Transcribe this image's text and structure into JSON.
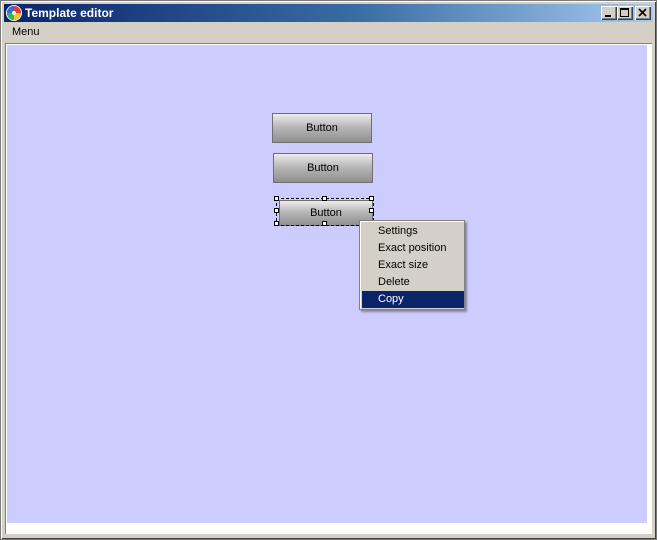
{
  "window": {
    "title": "Template editor",
    "controls": [
      "minimize-icon",
      "maximize-icon",
      "close-icon"
    ]
  },
  "menubar": {
    "items": [
      "Menu"
    ]
  },
  "canvas": {
    "background": "#ccccff",
    "buttons": [
      {
        "label": "Button",
        "selected": false
      },
      {
        "label": "Button",
        "selected": false
      },
      {
        "label": "Button",
        "selected": true
      }
    ]
  },
  "context_menu": {
    "items": [
      {
        "label": "Settings",
        "highlighted": false
      },
      {
        "label": "Exact position",
        "highlighted": false
      },
      {
        "label": "Exact size",
        "highlighted": false
      },
      {
        "label": "Delete",
        "highlighted": false
      },
      {
        "label": "Copy",
        "highlighted": true
      }
    ],
    "highlight_color": "#0a246a"
  }
}
